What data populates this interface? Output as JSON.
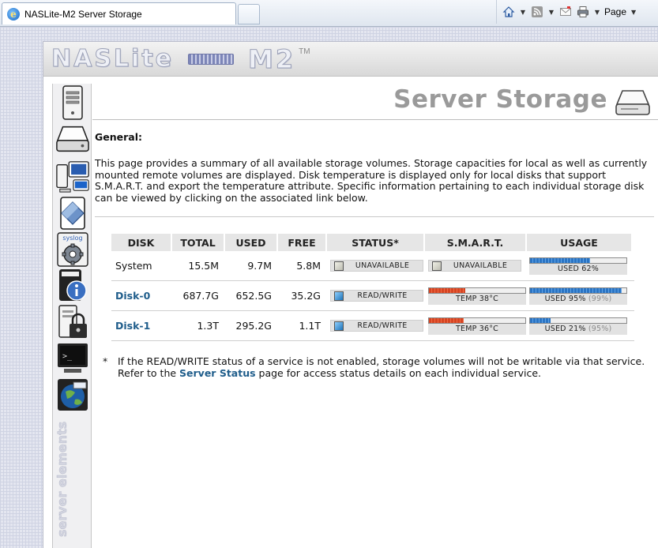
{
  "browser": {
    "tab_title": "NASLite-M2 Server Storage",
    "page_menu_label": "Page",
    "page_menu_arrow": "▼",
    "icons": [
      "home-icon",
      "rss-icon",
      "mail-icon",
      "print-icon"
    ]
  },
  "header": {
    "logo_word": "NASLite",
    "logo_model": "M2",
    "logo_tm": "TM"
  },
  "sidebar": {
    "items": [
      {
        "name": "server-status",
        "icon": "tower-server-icon"
      },
      {
        "name": "server-storage",
        "icon": "hard-disk-icon"
      },
      {
        "name": "network-services",
        "icon": "network-computers-icon"
      },
      {
        "name": "disk-info",
        "icon": "disk-cartridge-icon"
      },
      {
        "name": "syslog-settings",
        "icon": "syslog-gear-icon",
        "label": "syslog"
      },
      {
        "name": "information",
        "icon": "info-icon"
      },
      {
        "name": "security",
        "icon": "padlock-server-icon"
      },
      {
        "name": "console",
        "icon": "terminal-icon"
      },
      {
        "name": "web-access",
        "icon": "globe-window-icon"
      }
    ],
    "brand_text": "server elements"
  },
  "page": {
    "title": "Server Storage",
    "section_heading": "General:",
    "intro": "This page provides a summary of all available storage volumes. Storage capacities for local as well as currently mounted remote volumes are displayed. Disk temperature is displayed only for local disks that support S.M.A.R.T. and export the temperature attribute. Specific information pertaining to each individual storage disk can be viewed by clicking on the associated link below."
  },
  "table": {
    "headers": {
      "disk": "DISK",
      "total": "TOTAL",
      "used": "USED",
      "free": "FREE",
      "status": "STATUS*",
      "smart": "S.M.A.R.T.",
      "usage": "USAGE"
    },
    "rows": [
      {
        "disk": "System",
        "is_link": false,
        "total": "15.5M",
        "used": "9.7M",
        "free": "5.8M",
        "status": "UNAVAILABLE",
        "status_color": "gray",
        "smart_text": "UNAVAILABLE",
        "smart_has_bar": false,
        "smart_fill": 0,
        "usage_text": "USED 62%",
        "usage_extra": "",
        "usage_fill": 0.62
      },
      {
        "disk": "Disk-0",
        "is_link": true,
        "total": "687.7G",
        "used": "652.5G",
        "free": "35.2G",
        "status": "READ/WRITE",
        "status_color": "blue",
        "smart_text": "TEMP 38°C",
        "smart_has_bar": true,
        "smart_fill": 0.38,
        "usage_text": "USED 95%",
        "usage_extra": "(99%)",
        "usage_fill": 0.95
      },
      {
        "disk": "Disk-1",
        "is_link": true,
        "total": "1.3T",
        "used": "295.2G",
        "free": "1.1T",
        "status": "READ/WRITE",
        "status_color": "blue",
        "smart_text": "TEMP 36°C",
        "smart_has_bar": true,
        "smart_fill": 0.36,
        "usage_text": "USED 21%",
        "usage_extra": "(95%)",
        "usage_fill": 0.21
      }
    ]
  },
  "footnote": {
    "star": "*",
    "text_before": "If the READ/WRITE status of a service is not enabled, storage volumes will not be writable via that service. Refer to the ",
    "link": "Server Status",
    "text_after": " page for access status details on each individual service."
  },
  "colors": {
    "link": "#1f5d8b",
    "temp_bar": "#d64422",
    "usage_bar": "#2a74c4",
    "title_gray": "#9a9a9a"
  }
}
